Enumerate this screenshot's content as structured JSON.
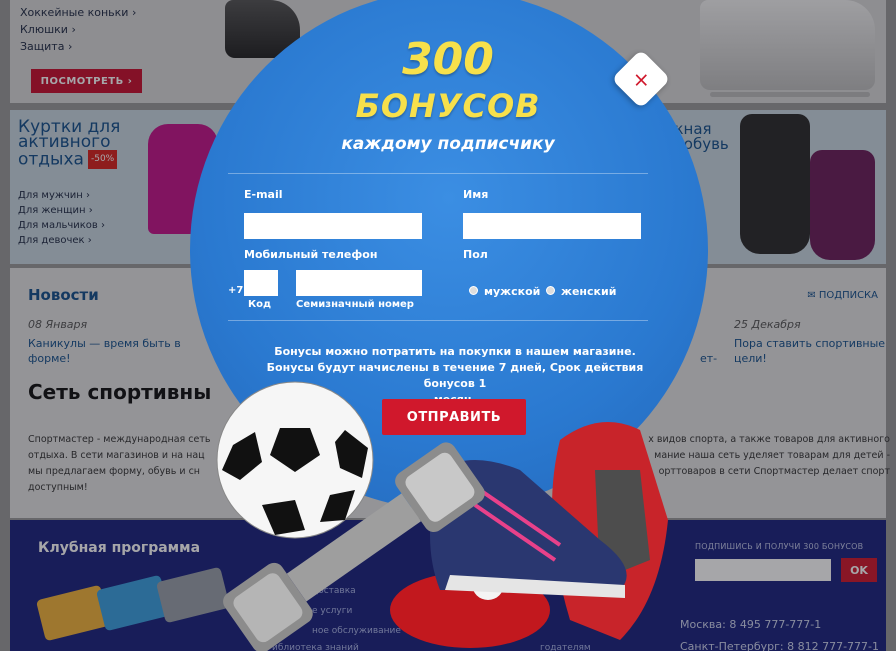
{
  "background": {
    "hockey_links": [
      "Хоккейные коньки ›",
      "Клюшки ›",
      "Защита ›"
    ],
    "see_button": "ПОСМОТРЕТЬ ›",
    "jackets": {
      "title_line1": "Куртки для",
      "title_line2": "активного",
      "title_line3": "отдыха",
      "badge": "-50%",
      "links": [
        "Для мужчин ›",
        "Для женщин ›",
        "Для мальчиков ›",
        "Для девочек ›"
      ]
    },
    "shoes_title_line1": "жная",
    "shoes_title_line2": "я обувь",
    "news": {
      "title": "Новости",
      "subscribe_link": "✉ ПОДПИСКА",
      "left_date": "08 Января",
      "left_text_line1": "Каникулы — время быть в",
      "left_text_line2": "форме!",
      "mid_text": "ет-",
      "right_date": "25 Декабря",
      "right_text_line1": "Пора ставить спортивные",
      "right_text_line2": "цели!"
    },
    "network": {
      "title": "Сеть спортивны",
      "text_line1_left": "Спортмастер - международная сеть",
      "text_line1_right": "х видов спорта, а также товаров для активного",
      "text_line2_left": "отдыха. В сети магазинов и на нац",
      "text_line2_right": "мание наша сеть уделяет товарам для детей -",
      "text_line3_left": "мы предлагаем форму, обувь и сн",
      "text_line3_right": "орттоваров в сети Спортмастер делает спорт",
      "text_line4": "доступным!"
    },
    "footer": {
      "club_title": "Клубная программа",
      "links": [
        "доставка",
        "е услуги",
        "ное обслуживание",
        "иблиотека знаний",
        "годателям"
      ],
      "subscribe_title": "ПОДПИШИСЬ И ПОЛУЧИ 300 БОНУСОВ",
      "ok_label": "OK",
      "phone_moscow": "Москва: 8 495 777-777-1",
      "phone_spb": "Санкт-Петербург: 8 812 777-777-1"
    }
  },
  "popup": {
    "headline_number": "300",
    "headline_word": "БОНУСОВ",
    "subheadline": "каждому подписчику",
    "close_label": "×",
    "email_label": "E-mail",
    "email_value": "",
    "name_label": "Имя",
    "name_value": "",
    "phone_label": "Мобильный телефон",
    "phone_prefix": "+7",
    "code_label": "Код",
    "number_label": "Семизначный номер",
    "gender_label": "Пол",
    "gender_male": "мужской",
    "gender_female": "женский",
    "info_line1": "Бонусы можно потратить на покупки в нашем магазине.",
    "info_line2": "Бонусы будут начислены в течение 7 дней, Срок действия бонусов 1",
    "info_line3": "месяц.",
    "submit_label": "ОТПРАВИТЬ"
  },
  "colors": {
    "popup_blue": "#2a79d0",
    "accent_red": "#d0182c",
    "headline_yellow": "#f7e04b",
    "footer_navy": "#1a237e"
  }
}
